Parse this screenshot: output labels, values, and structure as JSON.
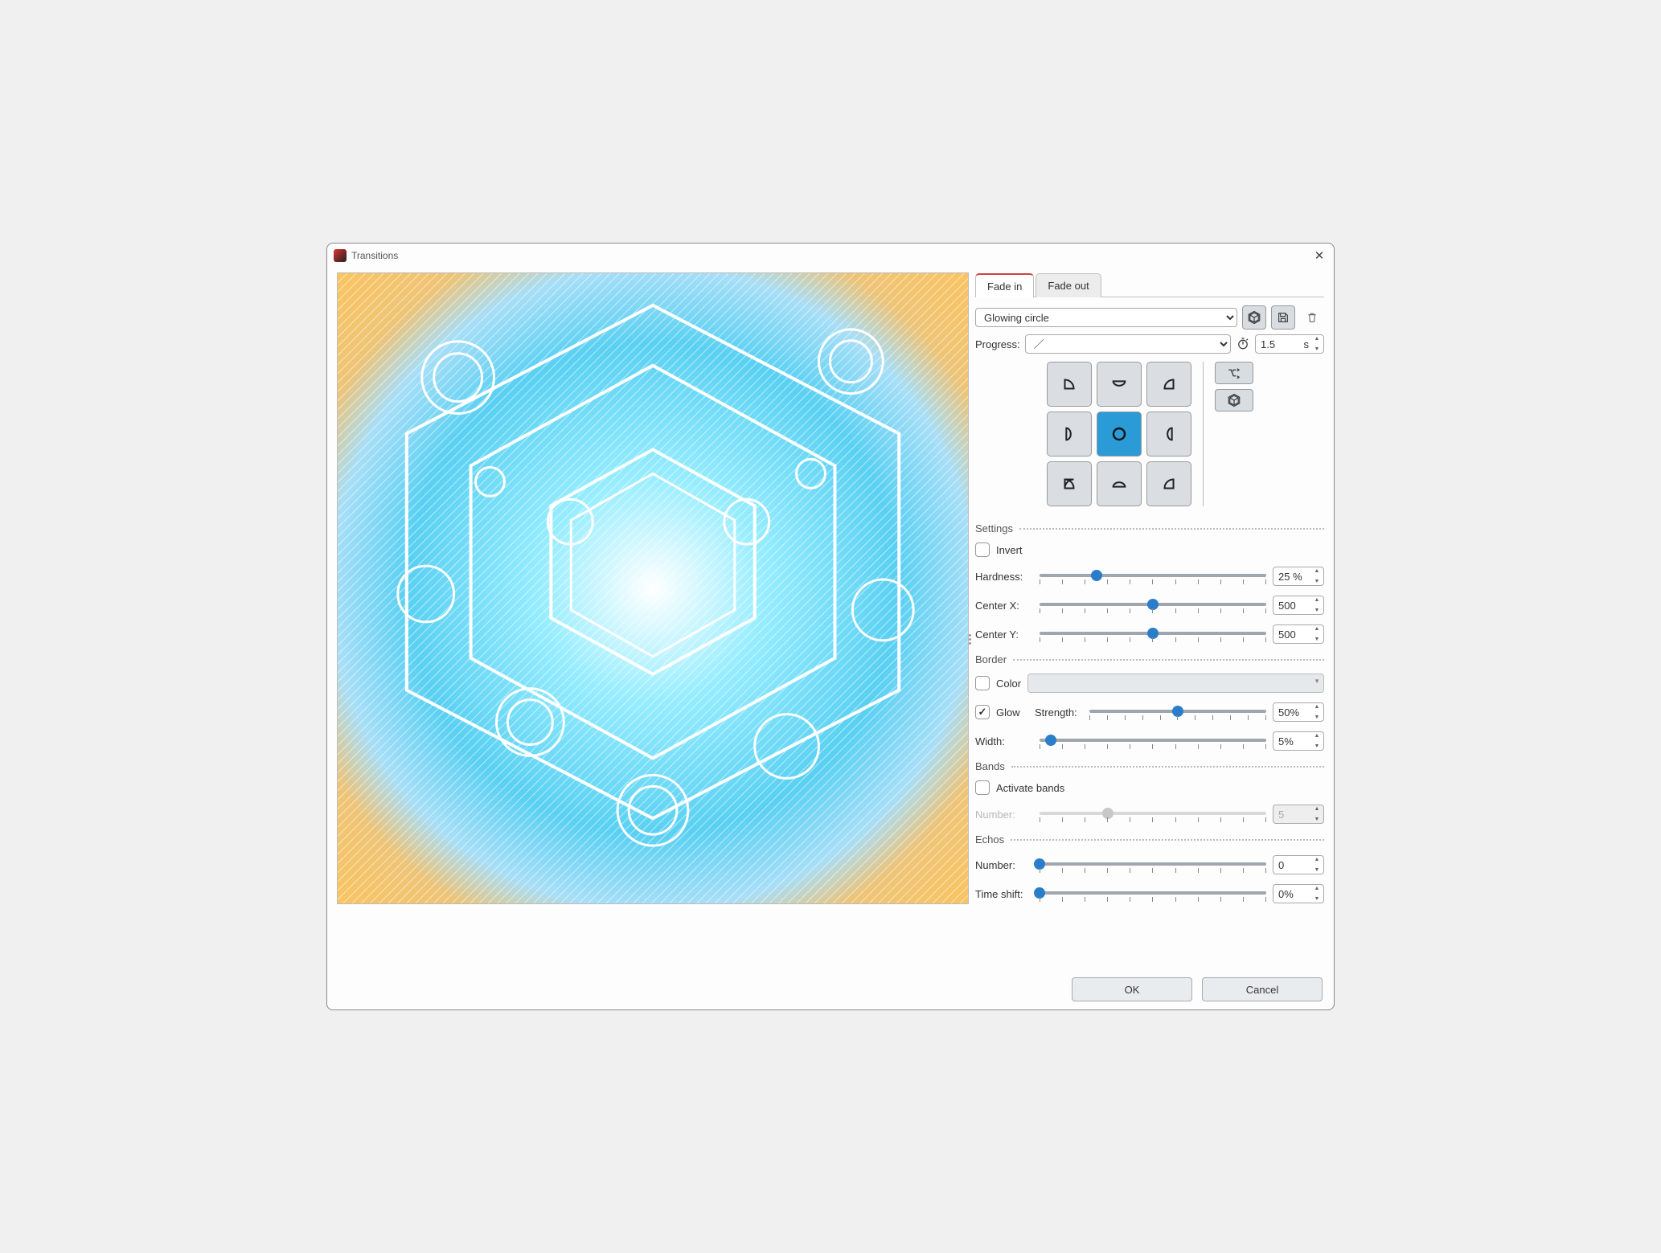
{
  "window": {
    "title": "Transitions"
  },
  "tabs": {
    "fade_in": "Fade in",
    "fade_out": "Fade out",
    "active": "fade_in"
  },
  "preset": {
    "name": "Glowing circle"
  },
  "progress": {
    "label": "Progress:",
    "curve": "",
    "duration": "1.5",
    "unit": "s"
  },
  "sections": {
    "settings": {
      "title": "Settings",
      "invert": {
        "label": "Invert",
        "checked": false
      },
      "hardness": {
        "label": "Hardness:",
        "value": "25 %",
        "pos": 25
      },
      "centerx": {
        "label": "Center X:",
        "value": "500",
        "pos": 50
      },
      "centery": {
        "label": "Center Y:",
        "value": "500",
        "pos": 50
      }
    },
    "border": {
      "title": "Border",
      "color": {
        "label": "Color",
        "checked": false
      },
      "glow": {
        "label": "Glow",
        "checked": true
      },
      "strength": {
        "label": "Strength:",
        "value": "50%",
        "pos": 50
      },
      "width": {
        "label": "Width:",
        "value": "5%",
        "pos": 5
      }
    },
    "bands": {
      "title": "Bands",
      "activate": {
        "label": "Activate bands",
        "checked": false
      },
      "number": {
        "label": "Number:",
        "value": "5",
        "pos": 30
      }
    },
    "echos": {
      "title": "Echos",
      "number": {
        "label": "Number:",
        "value": "0",
        "pos": 0
      },
      "timeshift": {
        "label": "Time shift:",
        "value": "0%",
        "pos": 0
      }
    }
  },
  "footer": {
    "ok": "OK",
    "cancel": "Cancel"
  }
}
